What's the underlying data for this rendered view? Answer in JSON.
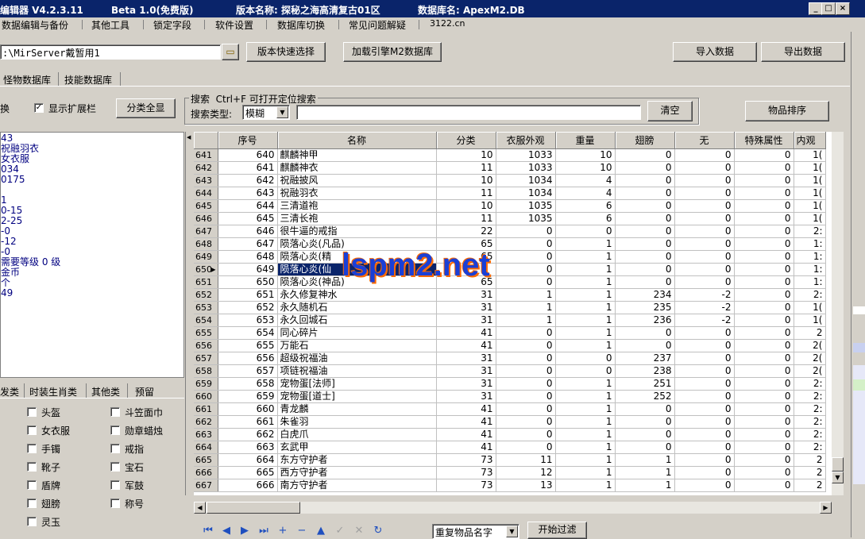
{
  "window": {
    "title_app": "编辑器 V4.2.3.11",
    "title_beta": "Beta 1.0(免费版)",
    "title_version": "版本名称: 探秘之海高清复古01区",
    "title_db": "数据库名: ApexM2.DB"
  },
  "menu": [
    "数据编辑与备份",
    "其他工具",
    "锁定字段",
    "软件设置",
    "数据库切换",
    "常见问题解疑",
    "3122.cn"
  ],
  "toolbar": {
    "path_value": ":\\MirServer戴暂用1",
    "quick_select": "版本快速选择",
    "load_engine": "加载引擎M2数据库",
    "import": "导入数据",
    "export": "导出数据"
  },
  "db_tabs": [
    "怪物数据库",
    "技能数据库"
  ],
  "left_panel": {
    "switch_label": "换",
    "show_ext_label": "显示扩展栏",
    "show_all_button": "分类全显",
    "info_lines": [
      "43",
      "祝融羽衣",
      "女衣服",
      "034",
      "0175",
      "",
      "1",
      "0-15",
      "2-25",
      "-0",
      "-12",
      "-0",
      "需要等级 0 级",
      "金币",
      "个",
      "49"
    ],
    "category_tabs": [
      "发类",
      "时装生肖类",
      "其他类",
      "预留"
    ],
    "categories_left": [
      "头盔",
      "女衣服",
      "手镯",
      "靴子",
      "盾牌",
      "翅膀",
      "灵玉"
    ],
    "categories_right": [
      "斗笠面巾",
      "勋章蜡烛",
      "戒指",
      "宝石",
      "军鼓",
      "称号"
    ]
  },
  "search": {
    "group_label": "搜索",
    "hint": "Ctrl+F 可打开定位搜索",
    "type_label": "搜索类型:",
    "type_value": "模糊",
    "query": "",
    "clear_button": "清空",
    "sort_button": "物品排序"
  },
  "table": {
    "columns": [
      "序号",
      "名称",
      "分类",
      "衣服外观",
      "重量",
      "翅膀",
      "无",
      "特殊属性",
      "内观"
    ],
    "selected_row_index": 9,
    "rows": [
      [
        "641",
        "640",
        "麒麟神甲",
        "10",
        "1033",
        "10",
        "0",
        "0",
        "0",
        "1("
      ],
      [
        "642",
        "641",
        "麒麟神衣",
        "11",
        "1033",
        "10",
        "0",
        "0",
        "0",
        "1("
      ],
      [
        "643",
        "642",
        "祝融披风",
        "10",
        "1034",
        "4",
        "0",
        "0",
        "0",
        "1("
      ],
      [
        "644",
        "643",
        "祝融羽衣",
        "11",
        "1034",
        "4",
        "0",
        "0",
        "0",
        "1("
      ],
      [
        "645",
        "644",
        "三清道袍",
        "10",
        "1035",
        "6",
        "0",
        "0",
        "0",
        "1("
      ],
      [
        "646",
        "645",
        "三清长袍",
        "11",
        "1035",
        "6",
        "0",
        "0",
        "0",
        "1("
      ],
      [
        "647",
        "646",
        "很牛逼的戒指",
        "22",
        "0",
        "0",
        "0",
        "0",
        "0",
        "2:"
      ],
      [
        "648",
        "647",
        "陨落心炎(凡品)",
        "65",
        "0",
        "1",
        "0",
        "0",
        "0",
        "1:"
      ],
      [
        "649",
        "648",
        "陨落心炎(精",
        "65",
        "0",
        "1",
        "0",
        "0",
        "0",
        "1:"
      ],
      [
        "650",
        "649",
        "陨落心炎(仙",
        "",
        "0",
        "1",
        "0",
        "0",
        "0",
        "1:"
      ],
      [
        "651",
        "650",
        "陨落心炎(神品)",
        "65",
        "0",
        "1",
        "0",
        "0",
        "0",
        "1:"
      ],
      [
        "652",
        "651",
        "永久修复神水",
        "31",
        "1",
        "1",
        "234",
        "-2",
        "0",
        "2:"
      ],
      [
        "653",
        "652",
        "永久随机石",
        "31",
        "1",
        "1",
        "235",
        "-2",
        "0",
        "1("
      ],
      [
        "654",
        "653",
        "永久回城石",
        "31",
        "1",
        "1",
        "236",
        "-2",
        "0",
        "1("
      ],
      [
        "655",
        "654",
        "同心碎片",
        "41",
        "0",
        "1",
        "0",
        "0",
        "0",
        "2"
      ],
      [
        "656",
        "655",
        "万能石",
        "41",
        "0",
        "1",
        "0",
        "0",
        "0",
        "2("
      ],
      [
        "657",
        "656",
        "超级祝福油",
        "31",
        "0",
        "0",
        "237",
        "0",
        "0",
        "2("
      ],
      [
        "658",
        "657",
        "项链祝福油",
        "31",
        "0",
        "0",
        "238",
        "0",
        "0",
        "2("
      ],
      [
        "659",
        "658",
        "宠物蛋[法师]",
        "31",
        "0",
        "1",
        "251",
        "0",
        "0",
        "2:"
      ],
      [
        "660",
        "659",
        "宠物蛋[道士]",
        "31",
        "0",
        "1",
        "252",
        "0",
        "0",
        "2:"
      ],
      [
        "661",
        "660",
        "青龙麟",
        "41",
        "0",
        "1",
        "0",
        "0",
        "0",
        "2:"
      ],
      [
        "662",
        "661",
        "朱雀羽",
        "41",
        "0",
        "1",
        "0",
        "0",
        "0",
        "2:"
      ],
      [
        "663",
        "662",
        "白虎爪",
        "41",
        "0",
        "1",
        "0",
        "0",
        "0",
        "2:"
      ],
      [
        "664",
        "663",
        "玄武甲",
        "41",
        "0",
        "1",
        "0",
        "0",
        "0",
        "2:"
      ],
      [
        "665",
        "664",
        "东方守护者",
        "73",
        "11",
        "1",
        "1",
        "0",
        "0",
        "2"
      ],
      [
        "666",
        "665",
        "西方守护者",
        "73",
        "12",
        "1",
        "1",
        "0",
        "0",
        "2"
      ],
      [
        "667",
        "666",
        "南方守护者",
        "73",
        "13",
        "1",
        "1",
        "0",
        "0",
        "2"
      ]
    ]
  },
  "bottom": {
    "filter_value": "重复物品名字",
    "filter_button": "开始过滤"
  },
  "watermark": "lspm2.net",
  "colors": {
    "titlebar": "#0a246a",
    "selection": "#0a246a",
    "watermark_fill": "#1a3fd6",
    "watermark_outline": "#ff6a00"
  }
}
